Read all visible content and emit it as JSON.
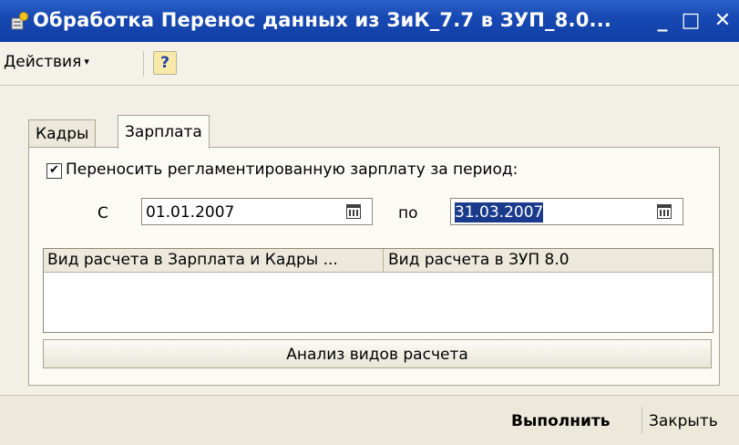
{
  "window": {
    "title": "Обработка  Перенос данных из ЗиК_7.7 в ЗУП_8.0...",
    "min_glyph": "_",
    "max_glyph": "□",
    "close_glyph": "✕",
    "title_bar_color": "#1849b2"
  },
  "toolbar": {
    "actions_label": "Действия",
    "actions_arrow": "▾",
    "help_label": "?"
  },
  "tabs": [
    {
      "label": "Кадры",
      "active": false
    },
    {
      "label": "Зарплата",
      "active": true
    }
  ],
  "salary_tab": {
    "transfer_checkbox": {
      "checked": true,
      "label": "Переносить регламентированную зарплату за период:"
    },
    "from_label": "С",
    "date_from": "01.01.2007",
    "to_label": "по",
    "date_to": "31.03.2007",
    "grid": {
      "columns": [
        "Вид расчета в Зарплата и Кадры ...",
        "Вид расчета в ЗУП 8.0"
      ],
      "rows": []
    },
    "analyze_button": "Анализ видов расчета"
  },
  "footer": {
    "run_button": "Выполнить",
    "close_button": "Закрыть"
  },
  "icons": {
    "app": "processing-icon",
    "help": "question-icon",
    "calendar": "calendar-icon"
  }
}
